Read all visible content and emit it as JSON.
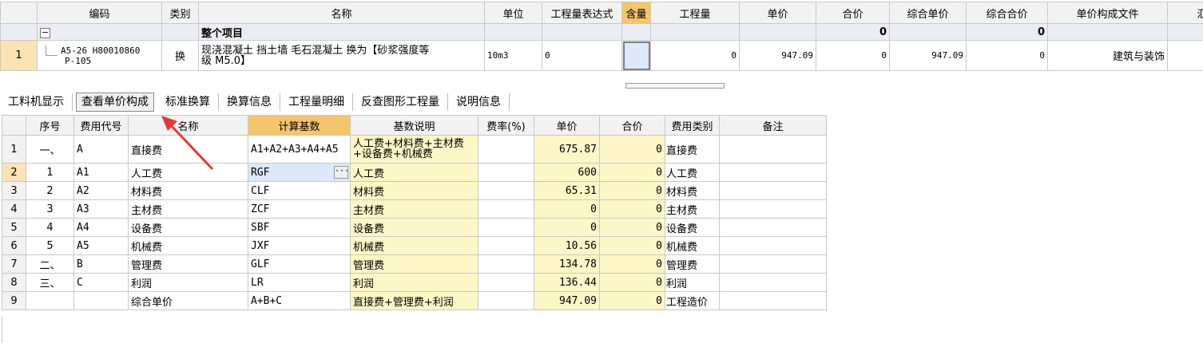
{
  "top": {
    "headers": [
      "编码",
      "类别",
      "名称",
      "单位",
      "工程量表达式",
      "含量",
      "工程量",
      "单价",
      "合价",
      "综合单价",
      "综合合价",
      "单价构成文件",
      "汇总"
    ],
    "group_row": {
      "name": "整个项目",
      "hejia": "0",
      "zonghe_hejia": "0"
    },
    "item_row": {
      "index": "1",
      "code_line1": "A5-26 H80010860",
      "code_line2": "P-105",
      "category": "换",
      "name_line1": "现浇混凝土 挡土墙 毛石混凝土  换为【砂浆强度等",
      "name_line2": "级 M5.0】",
      "unit": "10m3",
      "expression": "0",
      "quantity": "0",
      "unit_price": "947.09",
      "total": "0",
      "composite_price": "947.09",
      "composite_total": "0",
      "price_file": "建筑与装饰"
    }
  },
  "tabs": [
    "工料机显示",
    "查看单价构成",
    "标准换算",
    "换算信息",
    "工程量明细",
    "反查图形工程量",
    "说明信息"
  ],
  "active_tab": "查看单价构成",
  "bottom": {
    "headers": [
      "",
      "序号",
      "费用代号",
      "名称",
      "计算基数",
      "基数说明",
      "费率(%)",
      "单价",
      "合价",
      "费用类别",
      "备注"
    ],
    "rows": [
      {
        "n": "1",
        "seq": "一、",
        "code": "A",
        "name": "直接费",
        "base": "A1+A2+A3+A4+A5",
        "desc": "人工费+材料费+主材费+设备费+机械费",
        "rate": "",
        "price": "675.87",
        "total": "0",
        "type": "直接费",
        "note": ""
      },
      {
        "n": "2",
        "seq": "1",
        "code": "A1",
        "name": "人工费",
        "base": "RGF",
        "desc": "人工费",
        "rate": "",
        "price": "600",
        "total": "0",
        "type": "人工费",
        "note": ""
      },
      {
        "n": "3",
        "seq": "2",
        "code": "A2",
        "name": "材料费",
        "base": "CLF",
        "desc": "材料费",
        "rate": "",
        "price": "65.31",
        "total": "0",
        "type": "材料费",
        "note": ""
      },
      {
        "n": "4",
        "seq": "3",
        "code": "A3",
        "name": "主材费",
        "base": "ZCF",
        "desc": "主材费",
        "rate": "",
        "price": "0",
        "total": "0",
        "type": "主材费",
        "note": ""
      },
      {
        "n": "5",
        "seq": "4",
        "code": "A4",
        "name": "设备费",
        "base": "SBF",
        "desc": "设备费",
        "rate": "",
        "price": "0",
        "total": "0",
        "type": "设备费",
        "note": ""
      },
      {
        "n": "6",
        "seq": "5",
        "code": "A5",
        "name": "机械费",
        "base": "JXF",
        "desc": "机械费",
        "rate": "",
        "price": "10.56",
        "total": "0",
        "type": "机械费",
        "note": ""
      },
      {
        "n": "7",
        "seq": "二、",
        "code": "B",
        "name": "管理费",
        "base": "GLF",
        "desc": "管理费",
        "rate": "",
        "price": "134.78",
        "total": "0",
        "type": "管理费",
        "note": ""
      },
      {
        "n": "8",
        "seq": "三、",
        "code": "C",
        "name": "利润",
        "base": "LR",
        "desc": "利润",
        "rate": "",
        "price": "136.44",
        "total": "0",
        "type": "利润",
        "note": ""
      },
      {
        "n": "9",
        "seq": "",
        "code": "",
        "name": "综合单价",
        "base": "A+B+C",
        "desc": "直接费+管理费+利润",
        "rate": "",
        "price": "947.09",
        "total": "0",
        "type": "工程造价",
        "note": ""
      }
    ]
  },
  "colors": {
    "highlight_header": "#f5c56b",
    "yellow_cell": "#fdf6c6",
    "selected": "#dbe9f8",
    "arrow": "#e53935"
  }
}
